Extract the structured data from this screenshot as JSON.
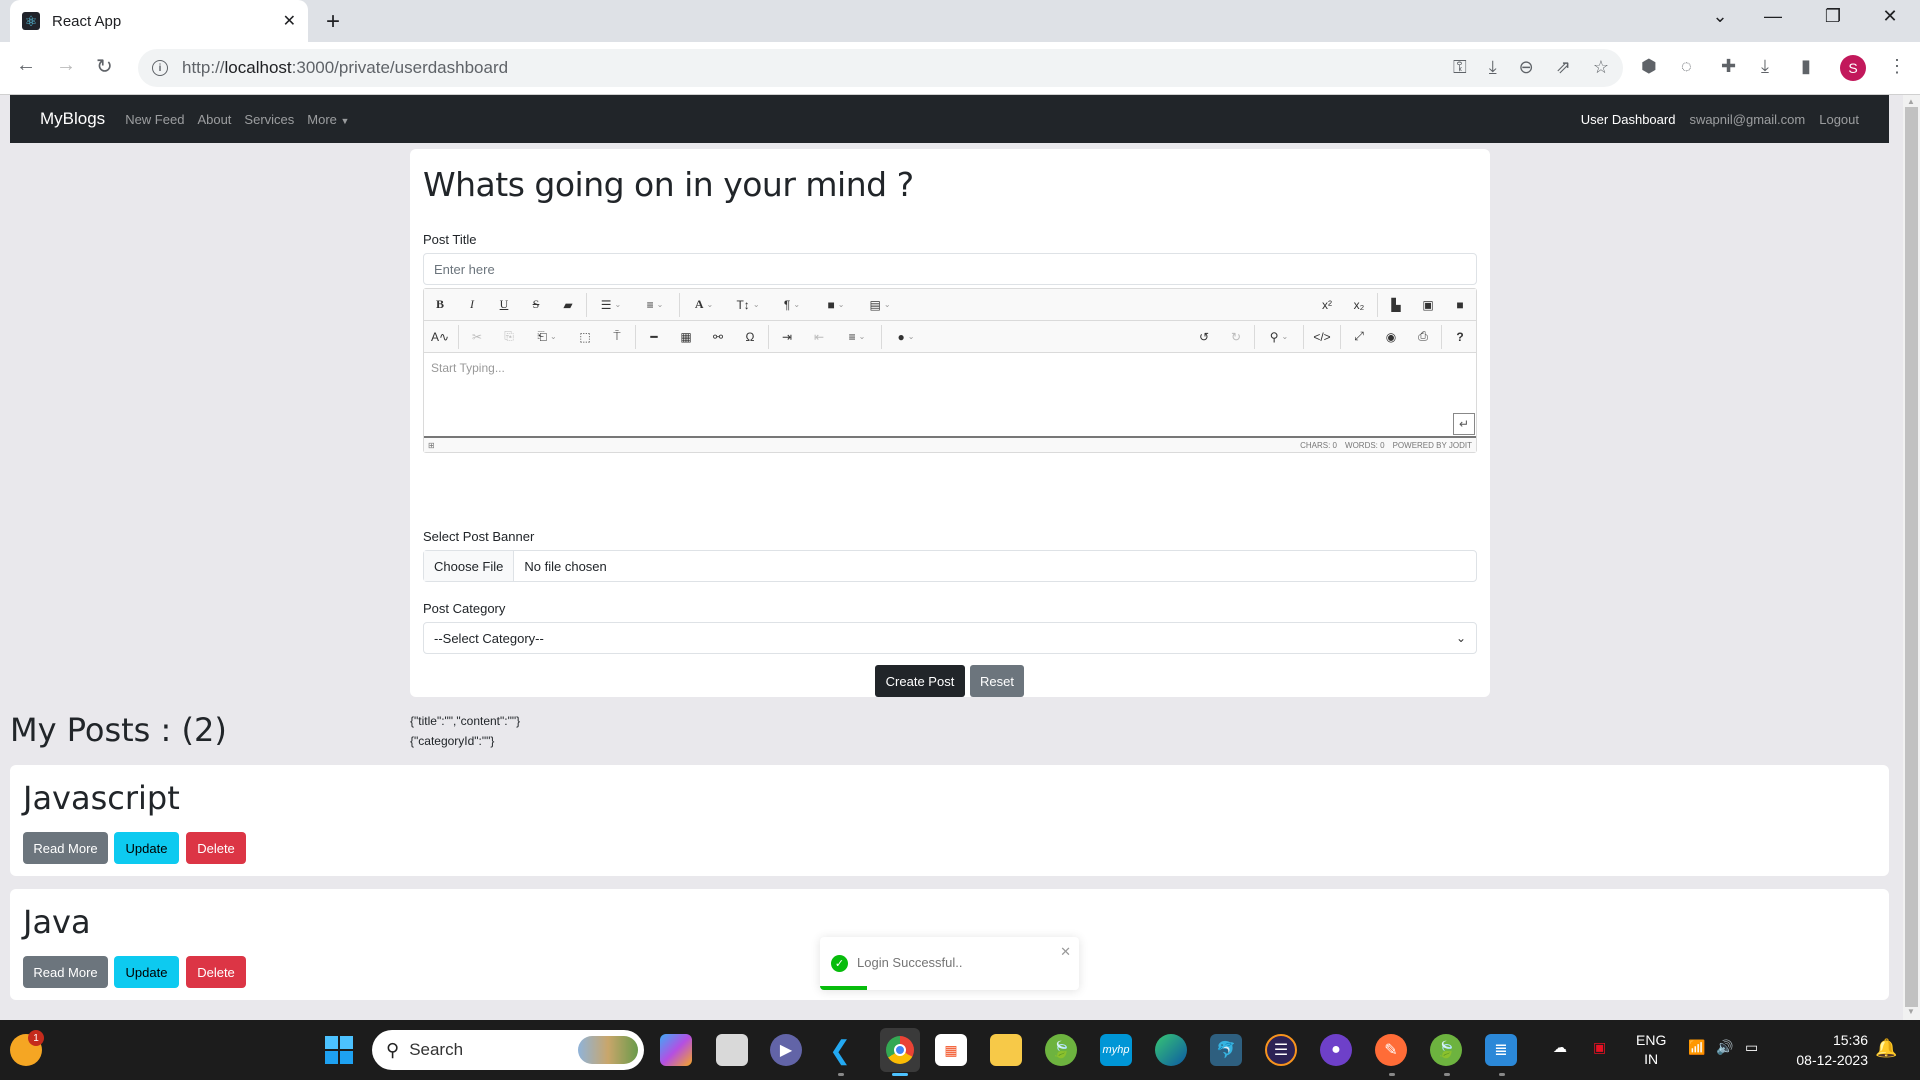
{
  "browser": {
    "tab_title": "React App",
    "tab_favicon": "react-icon",
    "url_prefix": "http://",
    "url_host": "localhost",
    "url_rest": ":3000/private/userdashboard",
    "profile_initial": "S",
    "profile_color": "#c2185b"
  },
  "navbar": {
    "brand": "MyBlogs",
    "links": [
      "New Feed",
      "About",
      "Services",
      "More"
    ],
    "right": {
      "dashboard": "User Dashboard",
      "email": "swapnil@gmail.com",
      "logout": "Logout"
    }
  },
  "form": {
    "heading": "Whats going on in your mind ?",
    "title_label": "Post Title",
    "title_placeholder": "Enter here",
    "editor": {
      "placeholder": "Start Typing...",
      "toolbar_row1": [
        "bold",
        "italic",
        "underline",
        "strikethrough",
        "eraser",
        "ul",
        "ol",
        "font",
        "font-size",
        "paragraph",
        "classSpan",
        "line-height",
        "superscript",
        "subscript",
        "file",
        "image",
        "video"
      ],
      "toolbar_row2": [
        "spellcheck",
        "cut",
        "copy",
        "paste",
        "select-all",
        "copy-format",
        "hr",
        "table",
        "link",
        "symbols",
        "indent",
        "outdent",
        "align",
        "brush",
        "undo",
        "redo",
        "find",
        "source",
        "fullsize",
        "preview",
        "print",
        "about"
      ],
      "chars": "CHARS: 0",
      "words": "WORDS: 0",
      "powered": "POWERED BY JODIT"
    },
    "banner_label": "Select Post Banner",
    "choose_file": "Choose File",
    "no_file": "No file chosen",
    "category_label": "Post Category",
    "category_selected": "--Select Category--",
    "create_button": "Create Post",
    "reset_button": "Reset",
    "debug_line1": "{\"title\":\"\",\"content\":\"\"}",
    "debug_line2": "{\"categoryId\":\"\"}"
  },
  "posts": {
    "heading": "My Posts : (2)",
    "items": [
      {
        "title": "Javascript",
        "read_more": "Read More",
        "update": "Update",
        "delete": "Delete"
      },
      {
        "title": "Java",
        "read_more": "Read More",
        "update": "Update",
        "delete": "Delete"
      }
    ]
  },
  "toast": {
    "message": "Login Successful..",
    "progress_percent": 18,
    "color": "#07bc0c"
  },
  "taskbar": {
    "search_placeholder": "Search",
    "weather_badge": "1",
    "language": "ENG",
    "region": "IN",
    "time": "15:36",
    "date": "08-12-2023"
  }
}
